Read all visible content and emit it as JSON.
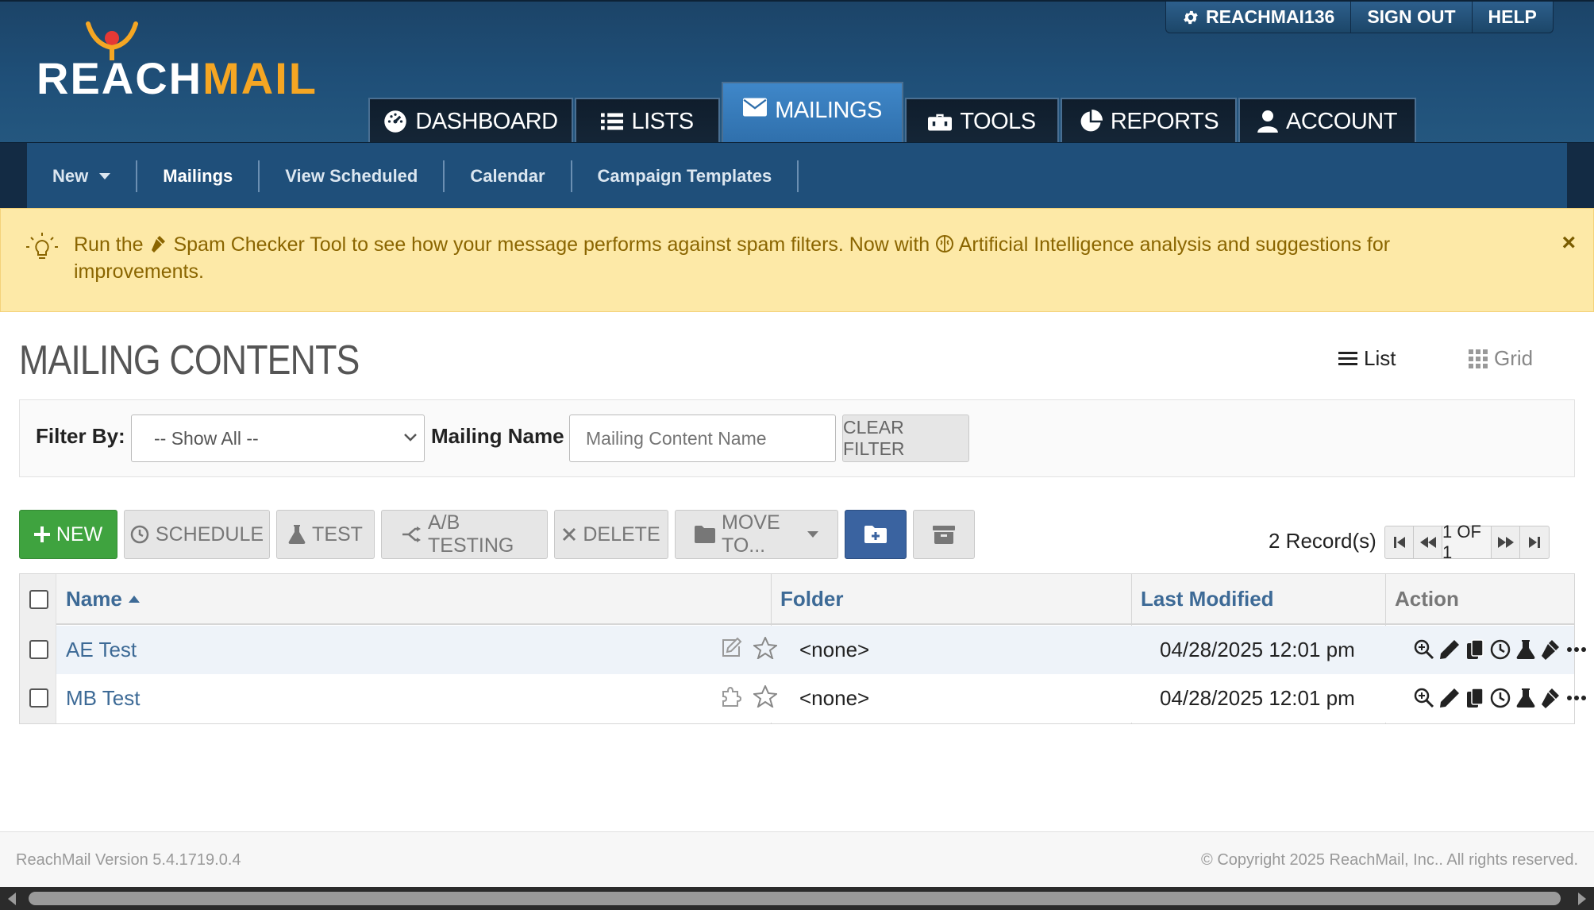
{
  "brand": {
    "reach": "REACH",
    "mail": "MAIL",
    "accent": "#f5a623",
    "dot_color": "#e53935"
  },
  "user_bar": {
    "account": "REACHMAI136",
    "sign_out": "SIGN OUT",
    "help": "HELP"
  },
  "main_nav": {
    "dashboard": "DASHBOARD",
    "lists": "LISTS",
    "mailings": "MAILINGS",
    "tools": "TOOLS",
    "reports": "REPORTS",
    "account": "ACCOUNT",
    "active": "mailings"
  },
  "sub_nav": {
    "new": "New",
    "mailings": "Mailings",
    "view_scheduled": "View Scheduled",
    "calendar": "Calendar",
    "campaign_templates": "Campaign Templates"
  },
  "alert": {
    "part1": "Run the",
    "link1": "Spam Checker Tool",
    "part2": "to see how your message performs against spam filters. Now with",
    "link2": "Artificial Intelligence",
    "part3": "analysis and suggestions for improvements.",
    "close": "×"
  },
  "page": {
    "title": "MAILING CONTENTS",
    "view_list": "List",
    "view_grid": "Grid",
    "active_view": "list"
  },
  "filter": {
    "filter_by_label": "Filter By:",
    "filter_by_value": "-- Show All --",
    "mailing_name_label": "Mailing Name",
    "mailing_name_placeholder": "Mailing Content Name",
    "mailing_name_value": "",
    "clear": "CLEAR FILTER"
  },
  "toolbar": {
    "new": "NEW",
    "schedule": "SCHEDULE",
    "test": "TEST",
    "ab_testing": "A/B TESTING",
    "delete": "DELETE",
    "move_to": "MOVE TO..."
  },
  "pagination": {
    "records": "2 Record(s)",
    "page": "1 OF 1"
  },
  "table": {
    "columns": {
      "name": "Name",
      "folder": "Folder",
      "last_modified": "Last Modified",
      "action": "Action"
    },
    "sort": {
      "column": "name",
      "direction": "ascending"
    },
    "rows": [
      {
        "name": "AE Test",
        "folder": "<none>",
        "last_modified": "04/28/2025 12:01 pm",
        "type_icon": "edit-icon",
        "favorite": false
      },
      {
        "name": "MB Test",
        "folder": "<none>",
        "last_modified": "04/28/2025 12:01 pm",
        "type_icon": "puzzle-icon",
        "favorite": false
      }
    ]
  },
  "footer": {
    "version": "ReachMail Version 5.4.1719.0.4",
    "copyright": "© Copyright 2025 ReachMail, Inc.. All rights reserved."
  },
  "colors": {
    "header_bg": "#1f4f78",
    "active_tab": "#3f87c9",
    "alert_bg": "#fde9a7",
    "alert_text": "#8a6500",
    "new_button": "#3fa33f",
    "folder_button": "#3a63a0",
    "link": "#3d6a96"
  }
}
